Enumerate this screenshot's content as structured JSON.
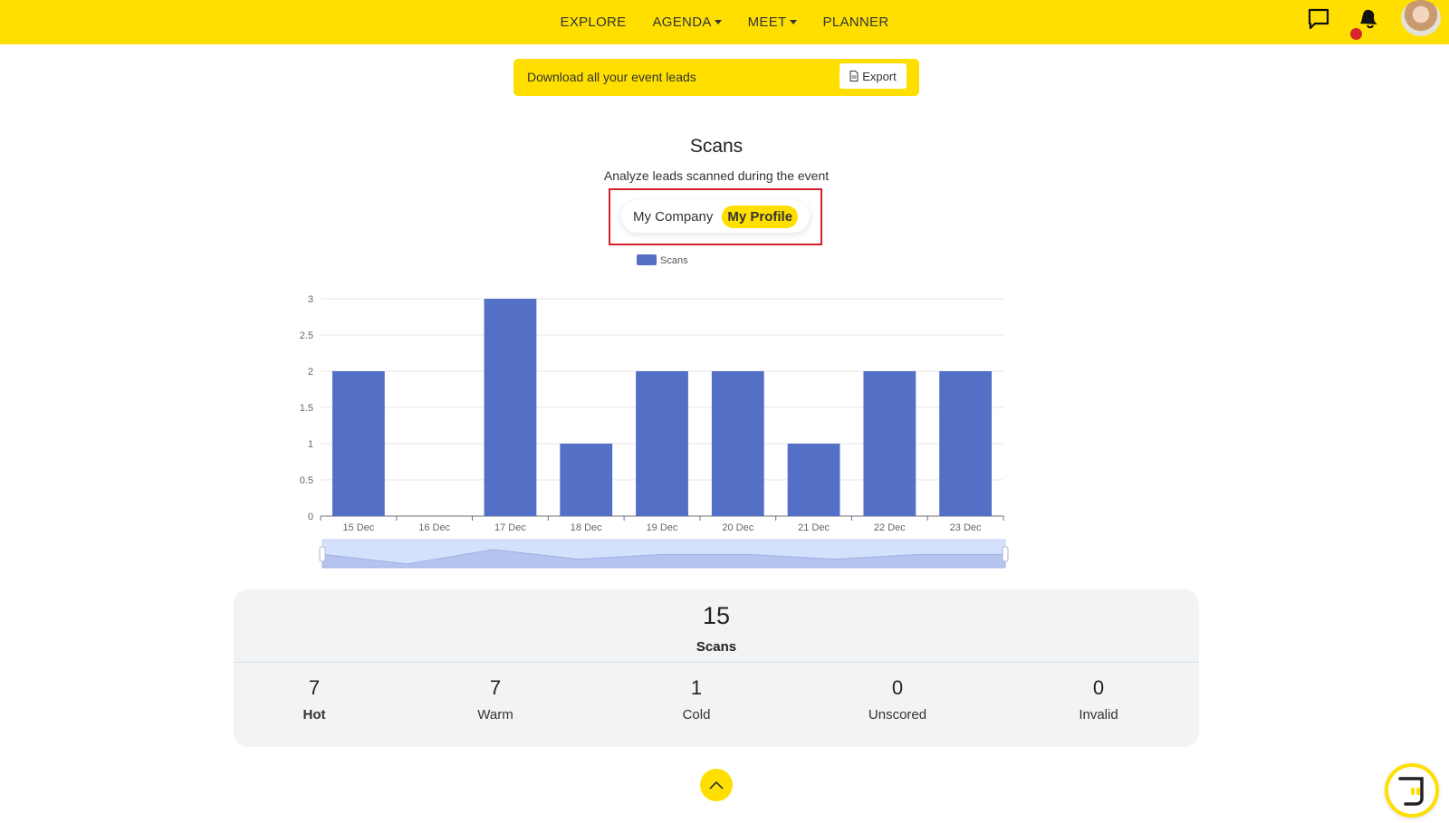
{
  "nav": {
    "items": [
      {
        "label": "EXPLORE",
        "dropdown": false
      },
      {
        "label": "AGENDA",
        "dropdown": true
      },
      {
        "label": "MEET",
        "dropdown": true
      },
      {
        "label": "PLANNER",
        "dropdown": false
      }
    ],
    "icons": [
      "chat-icon",
      "bell-icon",
      "avatar"
    ]
  },
  "export": {
    "text": "Download all your event leads",
    "button_label": "Export",
    "icon": "doc-icon"
  },
  "scans": {
    "title": "Scans",
    "subtitle": "Analyze leads scanned during the event",
    "toggle": {
      "options": [
        "My Company",
        "My Profile"
      ],
      "selected": "My Profile"
    }
  },
  "chart_data": {
    "type": "bar",
    "categories": [
      "15 Dec",
      "16 Dec",
      "17 Dec",
      "18 Dec",
      "19 Dec",
      "20 Dec",
      "21 Dec",
      "22 Dec",
      "23 Dec"
    ],
    "series": [
      {
        "name": "Scans",
        "values": [
          2,
          0,
          3,
          1,
          2,
          2,
          1,
          2,
          2
        ]
      }
    ],
    "y_ticks": [
      "0",
      "0.5",
      "1",
      "1.5",
      "2",
      "2.5",
      "3"
    ],
    "ylim": [
      0,
      3
    ],
    "legend_placement": "top",
    "grid": true,
    "bar_color": "#5470c6",
    "has_zoom_slider": true
  },
  "stats": {
    "total_value": "15",
    "total_label": "Scans",
    "items": [
      {
        "value": "7",
        "label": "Hot"
      },
      {
        "value": "7",
        "label": "Warm"
      },
      {
        "value": "1",
        "label": "Cold"
      },
      {
        "value": "0",
        "label": "Unscored"
      },
      {
        "value": "0",
        "label": "Invalid"
      }
    ]
  },
  "colors": {
    "brand_yellow": "#ffdf00",
    "highlight_red": "#d51f2a",
    "bar_blue": "#5470c6",
    "panel_gray": "#f1f3f5"
  }
}
